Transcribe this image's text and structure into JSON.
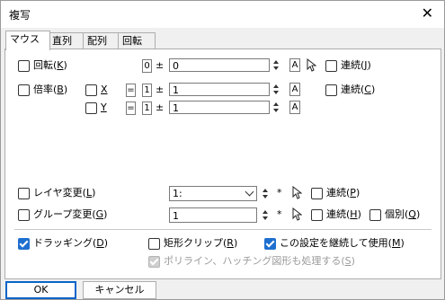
{
  "window": {
    "title": "複写",
    "close_label": "✕"
  },
  "tabs": [
    "マウス",
    "直列",
    "配列",
    "回転"
  ],
  "rotate": {
    "label": "回転(",
    "key": "K",
    "tail": ")",
    "sel": "0",
    "pm": "±",
    "value": "0",
    "abtn": "A",
    "cont_label": "連続(",
    "cont_key": "J",
    "cont_tail": ")"
  },
  "scale": {
    "label": "倍率(",
    "key": "B",
    "tail": ")",
    "x_label": "X",
    "y_label": "Y",
    "x_eq": "=",
    "x_sel": "1",
    "x_pm": "±",
    "x_value": "1",
    "x_abtn": "A",
    "y_eq": "=",
    "y_sel": "1",
    "y_pm": "±",
    "y_value": "1",
    "y_abtn": "A",
    "cont_label": "連続(",
    "cont_key": "C",
    "cont_tail": ")"
  },
  "layer": {
    "label": "レイヤ変更(",
    "key": "L",
    "tail": ")",
    "value": "1:",
    "star": "*",
    "cont_label": "連続(",
    "cont_key": "P",
    "cont_tail": ")"
  },
  "group": {
    "label": "グループ変更(",
    "key": "G",
    "tail": ")",
    "value": "1",
    "star": "*",
    "cont_label": "連続(",
    "cont_key": "H",
    "cont_tail": ")",
    "indiv_label": "個別(",
    "indiv_key": "Q",
    "indiv_tail": ")"
  },
  "bottom": {
    "drag_label": "ドラッギング(",
    "drag_key": "D",
    "drag_tail": ")",
    "rectclip_label": "矩形クリップ(",
    "rectclip_key": "R",
    "rectclip_tail": ")",
    "keep_label": "この設定を継続して使用(",
    "keep_key": "M",
    "keep_tail": ")",
    "poly_label": "ポリライン、ハッチング図形も処理する(",
    "poly_key": "S",
    "poly_tail": ")"
  },
  "buttons": {
    "ok": "OK",
    "cancel": "キャンセル"
  },
  "colors": {
    "accent": "#1f6fd0",
    "default_border": "#0a64c8"
  }
}
